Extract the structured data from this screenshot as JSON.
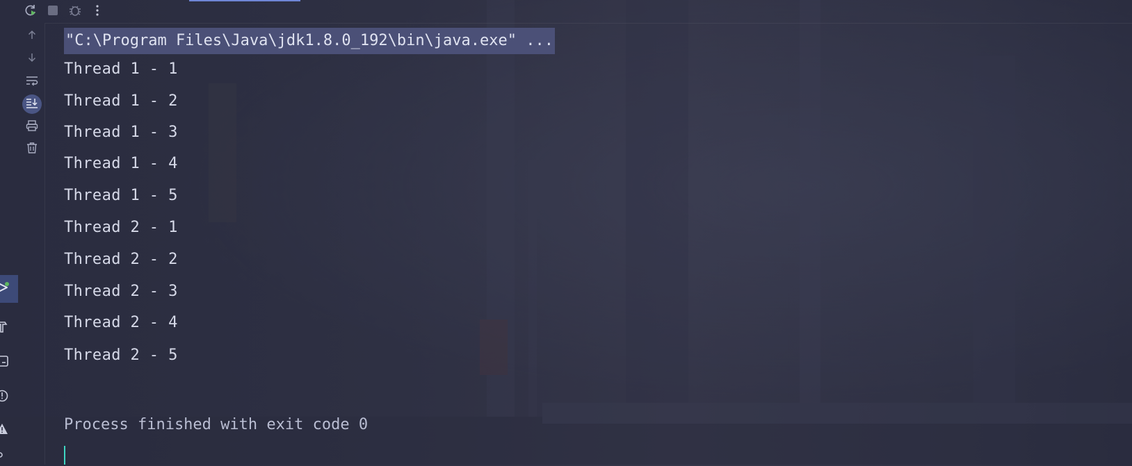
{
  "run_toolbar": {
    "items": [
      {
        "name": "rerun",
        "icon": "rerun-icon"
      },
      {
        "name": "stop",
        "icon": "stop-icon"
      },
      {
        "name": "debug",
        "icon": "bug-icon"
      },
      {
        "name": "more",
        "icon": "more-vertical-icon"
      }
    ]
  },
  "console_toolbar": {
    "items": [
      {
        "name": "up-stack-trace",
        "icon": "arrow-up-icon"
      },
      {
        "name": "down-stack-trace",
        "icon": "arrow-down-icon"
      },
      {
        "name": "soft-wrap",
        "icon": "soft-wrap-icon"
      },
      {
        "name": "scroll-to-end",
        "icon": "scroll-to-end-icon",
        "toggled": true
      },
      {
        "name": "print",
        "icon": "print-icon"
      },
      {
        "name": "clear-all",
        "icon": "trash-icon"
      }
    ]
  },
  "side_panel": {
    "items": [
      {
        "name": "run",
        "icon": "run-icon",
        "active": true
      },
      {
        "name": "build",
        "icon": "hammer-icon"
      },
      {
        "name": "terminal",
        "icon": "terminal-icon"
      },
      {
        "name": "problems",
        "icon": "problems-icon"
      },
      {
        "name": "warnings",
        "icon": "warning-icon"
      }
    ]
  },
  "console": {
    "command": "\"C:\\Program Files\\Java\\jdk1.8.0_192\\bin\\java.exe\" ...",
    "lines": [
      "Thread 1 - 1",
      "Thread 1 - 2",
      "Thread 1 - 3",
      "Thread 1 - 4",
      "Thread 1 - 5",
      "Thread 2 - 1",
      "Thread 2 - 2",
      "Thread 2 - 3",
      "Thread 2 - 4",
      "Thread 2 - 5"
    ],
    "exit_message": "Process finished with exit code 0"
  },
  "colors": {
    "accent": "#6f86d6",
    "selection": "#4b5077",
    "caret": "#3fd6c2",
    "text": "#d6d9e8"
  }
}
